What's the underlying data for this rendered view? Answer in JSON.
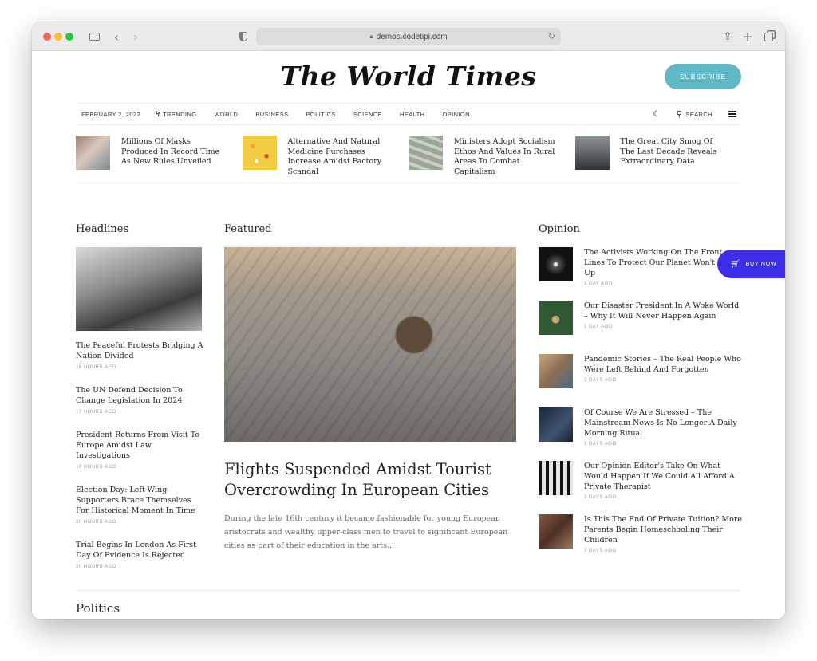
{
  "browser": {
    "url": "demos.codetipi.com",
    "colors": {
      "close": "#ff5f57",
      "minimize": "#febc2e",
      "zoom": "#28c840"
    }
  },
  "site": {
    "logo": "The World Times",
    "subscribe_label": "SUBSCRIBE",
    "accent_color": "#5fb8c6"
  },
  "nav": {
    "date": "FEBRUARY 2, 2022",
    "trending_label": "TRENDING",
    "links": [
      "WORLD",
      "BUSINESS",
      "POLITICS",
      "SCIENCE",
      "HEALTH",
      "OPINION"
    ],
    "search_label": "SEARCH"
  },
  "trending": [
    {
      "title": "Millions Of Masks Produced In Record Time As New Rules Unveiled",
      "thumb_color": "#b9a79a"
    },
    {
      "title": "Alternative And Natural Medicine Purchases Increase Amidst Factory Scandal",
      "thumb_color": "#e8c33c"
    },
    {
      "title": "Ministers Adopt Socialism Ethos And Values In Rural Areas To Combat Capitalism",
      "thumb_color": "#8f9a8f"
    },
    {
      "title": "The Great City Smog Of The Last Decade Reveals Extraordinary Data",
      "thumb_color": "#5b6062"
    }
  ],
  "headlines": {
    "section_title": "Headlines",
    "items": [
      {
        "title": "The Peaceful Protests Bridging A Nation Divided",
        "time": "16 HOURS AGO"
      },
      {
        "title": "The UN Defend Decision To Change Legislation In 2024",
        "time": "17 HOURS AGO"
      },
      {
        "title": "President Returns From Visit To Europe Amidst Law Investigations",
        "time": "19 HOURS AGO"
      },
      {
        "title": "Election Day: Left-Wing Supporters Brace Themselves For Historical Moment In Time",
        "time": "20 HOURS AGO"
      },
      {
        "title": "Trial Begins In London As First Day Of Evidence Is Rejected",
        "time": "20 HOURS AGO"
      }
    ]
  },
  "featured": {
    "section_title": "Featured",
    "title": "Flights Suspended Amidst Tourist Overcrowding In European Cities",
    "excerpt": "During the late 16th century it became fashionable for young European aristocrats and wealthy upper-class men to travel to significant European cities as part of their education in the arts..."
  },
  "opinion": {
    "section_title": "Opinion",
    "items": [
      {
        "title": "The Activists Working On The Front Lines To Protect Our Planet Won't Give Up",
        "time": "1 DAY AGO",
        "thumb_color": "#1a1a1a"
      },
      {
        "title": "Our Disaster President In A Woke World – Why It Will Never Happen Again",
        "time": "1 DAY AGO",
        "thumb_color": "#2f5a34"
      },
      {
        "title": "Pandemic Stories – The Real People Who Were Left Behind And Forgotten",
        "time": "2 DAYS AGO",
        "thumb_color": "#a48a6c"
      },
      {
        "title": "Of Course We Are Stressed – The Mainstream News Is No Longer A Daily Morning Ritual",
        "time": "3 DAYS AGO",
        "thumb_color": "#253548"
      },
      {
        "title": "Our Opinion Editor's Take On What Would Happen If We Could All Afford A Private Therapist",
        "time": "3 DAYS AGO",
        "thumb_color": "#d0d0d0"
      },
      {
        "title": "Is This The End Of Private Tuition? More Parents Begin Homeschooling Their Children",
        "time": "3 DAYS AGO",
        "thumb_color": "#6b4a38"
      }
    ]
  },
  "buy_now": {
    "label": "BUY NOW",
    "color": "#3b2ee6"
  },
  "politics": {
    "section_title": "Politics",
    "thumb_colors": [
      "#e89a9a",
      "#8a9298",
      "#7ea2c8",
      "#6f7478",
      "#2d3a20"
    ]
  }
}
